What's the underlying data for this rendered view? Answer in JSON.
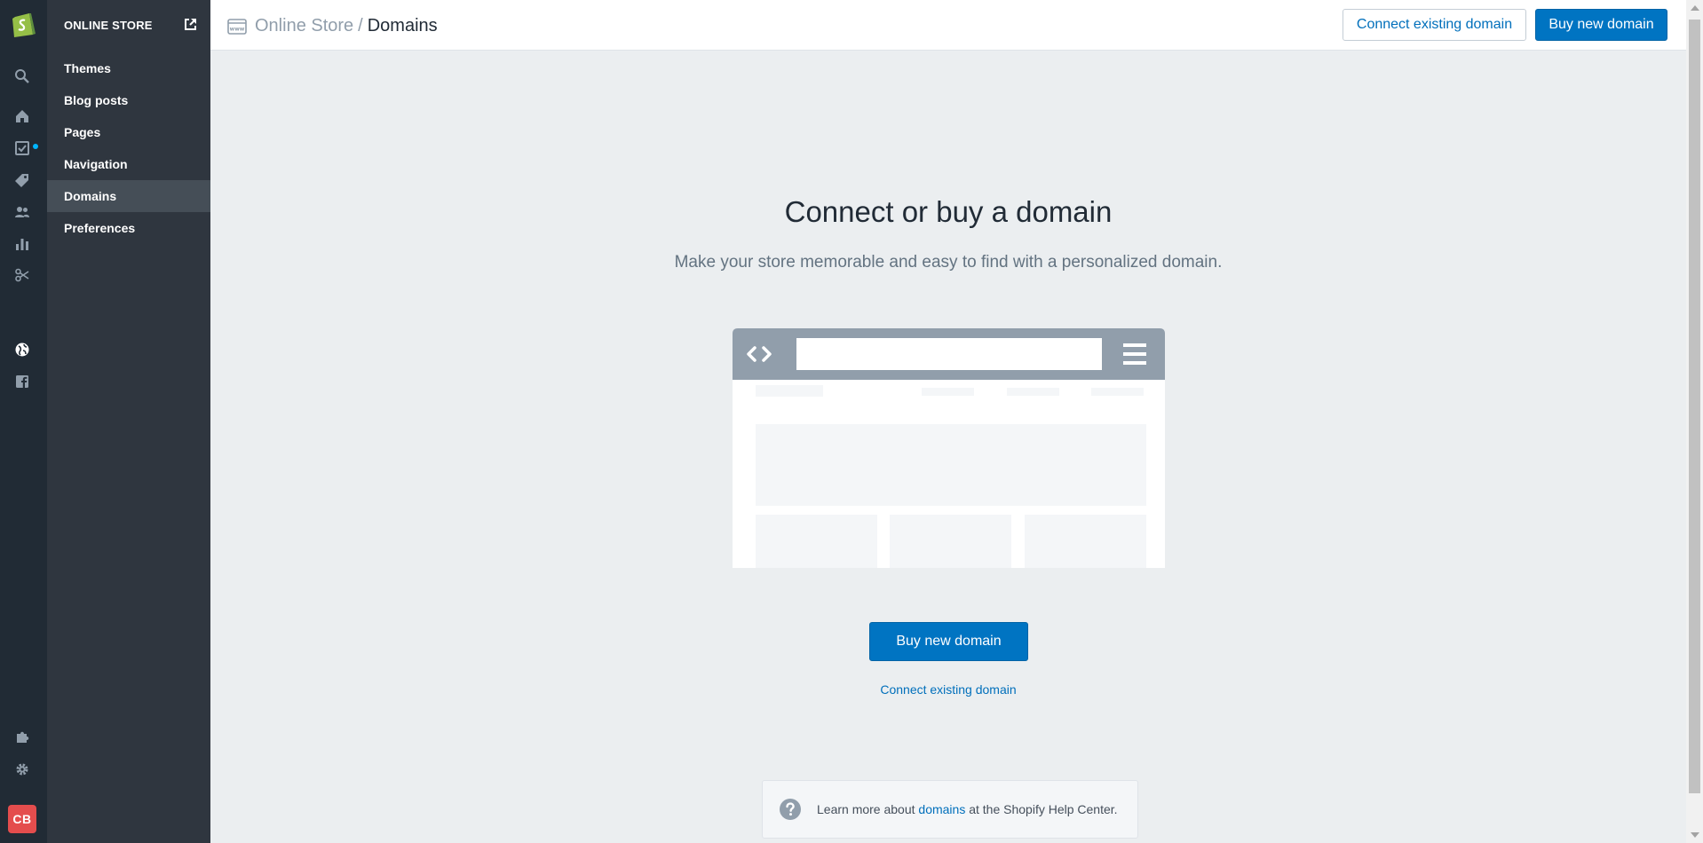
{
  "app": {
    "store_initials": "CB"
  },
  "rail": {
    "icons": [
      "shopify-logo-icon",
      "search-icon",
      "home-icon",
      "orders-icon",
      "products-tag-icon",
      "customers-icon",
      "analytics-icon",
      "discounts-icon",
      "online-store-globe-icon",
      "facebook-icon",
      "apps-puzzle-icon",
      "settings-gear-icon"
    ],
    "notification_color": "#00b5ff"
  },
  "sidebar": {
    "section_title": "ONLINE STORE",
    "items": [
      {
        "label": "Themes"
      },
      {
        "label": "Blog posts"
      },
      {
        "label": "Pages"
      },
      {
        "label": "Navigation"
      },
      {
        "label": "Domains",
        "active": true
      },
      {
        "label": "Preferences"
      }
    ]
  },
  "header": {
    "breadcrumb_parent": "Online Store",
    "breadcrumb_separator": "/",
    "breadcrumb_current": "Domains",
    "connect_label": "Connect existing domain",
    "buy_label": "Buy new domain"
  },
  "main": {
    "title": "Connect or buy a domain",
    "subtitle": "Make your store memorable and easy to find with a personalized domain.",
    "buy_button_label": "Buy new domain",
    "connect_link_label": "Connect existing domain"
  },
  "help": {
    "prefix": "Learn more about ",
    "link": "domains",
    "suffix": " at the Shopify Help Center."
  },
  "colors": {
    "primary": "#0074c2",
    "link": "#006fbb",
    "rail_bg": "#212b35",
    "sidebar_bg": "#2f363f",
    "page_bg": "#ebeef0"
  }
}
